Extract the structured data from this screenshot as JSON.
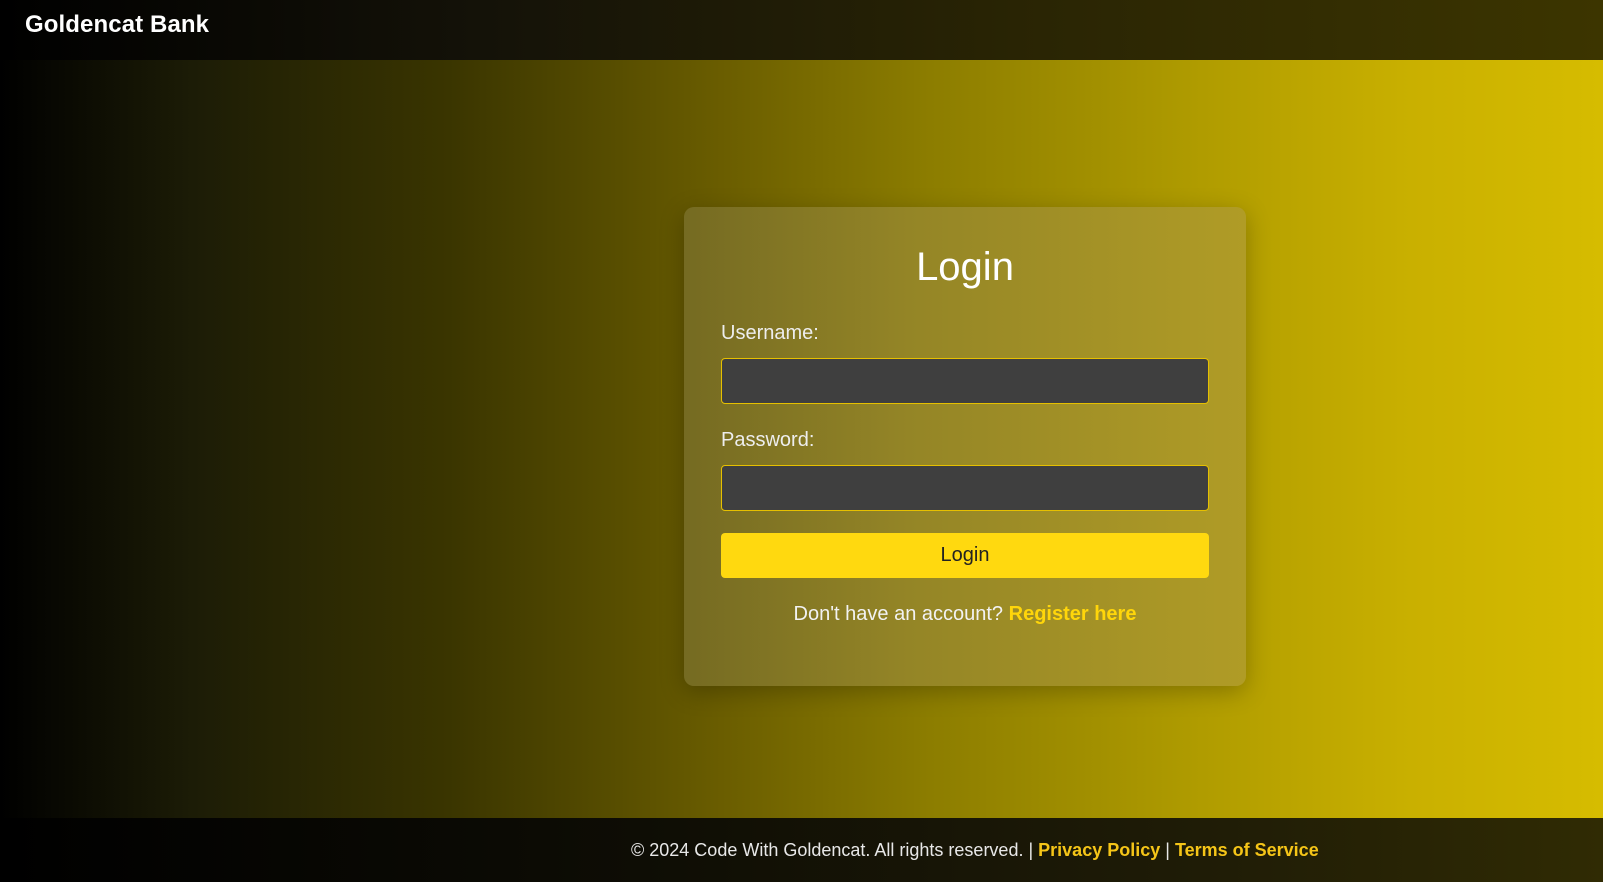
{
  "header": {
    "brand": "Goldencat Bank"
  },
  "login_form": {
    "title": "Login",
    "username_label": "Username:",
    "username_value": "",
    "password_label": "Password:",
    "password_value": "",
    "submit_label": "Login",
    "register_prompt": "Don't have an account?",
    "register_link": "Register here"
  },
  "footer": {
    "copyright": "© 2024 Code With Goldencat. All rights reserved. |",
    "privacy_link": "Privacy Policy",
    "separator": "|",
    "terms_link": "Terms of Service"
  },
  "colors": {
    "accent": "#ffd90f",
    "link": "#f5c518",
    "input_bg": "#3f3f3f"
  }
}
